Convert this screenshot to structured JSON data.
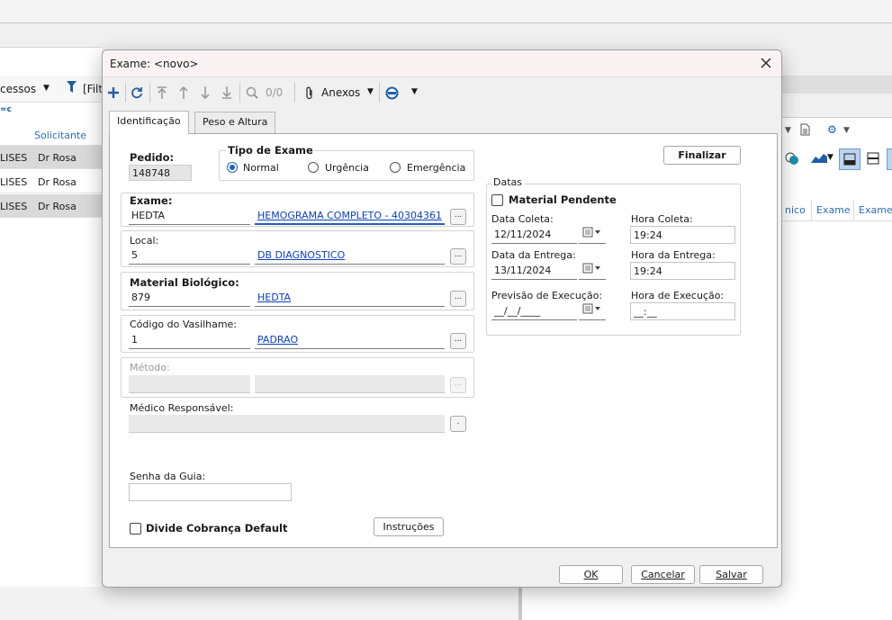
{
  "background": {
    "processos_label": "cessos",
    "filtro_label": "[Filt",
    "grid_header_solicitante": "Solicitante",
    "rows": [
      {
        "c1": "LISES",
        "c2": "Dr Rosa"
      },
      {
        "c1": "LISES",
        "c2": "Dr Rosa"
      },
      {
        "c1": "LISES",
        "c2": "Dr Rosa"
      }
    ],
    "right_cols": [
      "nico",
      "Exame",
      "Exame"
    ]
  },
  "dialog": {
    "title": "Exame: <novo>",
    "toolbar": {
      "counter": "0/0",
      "anexos_label": "Anexos"
    },
    "tabs": [
      "Identificação",
      "Peso e Altura"
    ],
    "pedido": {
      "label": "Pedido:",
      "value": "148748"
    },
    "tipo_exame": {
      "label": "Tipo de Exame",
      "options": [
        "Normal",
        "Urgência",
        "Emergência"
      ],
      "selected": "Normal"
    },
    "exame": {
      "label": "Exame:",
      "code": "HEDTA",
      "desc": "HEMOGRAMA COMPLETO - 40304361"
    },
    "local": {
      "label": "Local:",
      "code": "5",
      "desc": "DB DIAGNOSTICO"
    },
    "material": {
      "label": "Material Biológico:",
      "code": "879",
      "desc": "HEDTA"
    },
    "vasilhame": {
      "label": "Código do Vasilhame:",
      "code": "1",
      "desc": "PADRAO"
    },
    "metodo": {
      "label": "Método:"
    },
    "medico": {
      "label": "Médico Responsável:"
    },
    "senha_guia": {
      "label": "Senha da Guia:",
      "value": ""
    },
    "divide_cobranca": {
      "label": "Divide Cobrança Default"
    },
    "instrucoes_label": "Instruções",
    "finalizar_label": "Finalizar",
    "datas": {
      "legend": "Datas",
      "material_pendente": "Material Pendente",
      "data_coleta_label": "Data Coleta:",
      "data_coleta": "12/11/2024",
      "hora_coleta_label": "Hora Coleta:",
      "hora_coleta": "19:24",
      "data_entrega_label": "Data da Entrega:",
      "data_entrega": "13/11/2024",
      "hora_entrega_label": "Hora da Entrega:",
      "hora_entrega": "19:24",
      "previsao_label": "Previsão de Execução:",
      "previsao": "__/__/____",
      "hora_exec_label": "Hora de Execução:",
      "hora_exec": "__:__"
    },
    "footer": {
      "ok": "OK",
      "cancelar": "Cancelar",
      "salvar": "Salvar"
    }
  }
}
